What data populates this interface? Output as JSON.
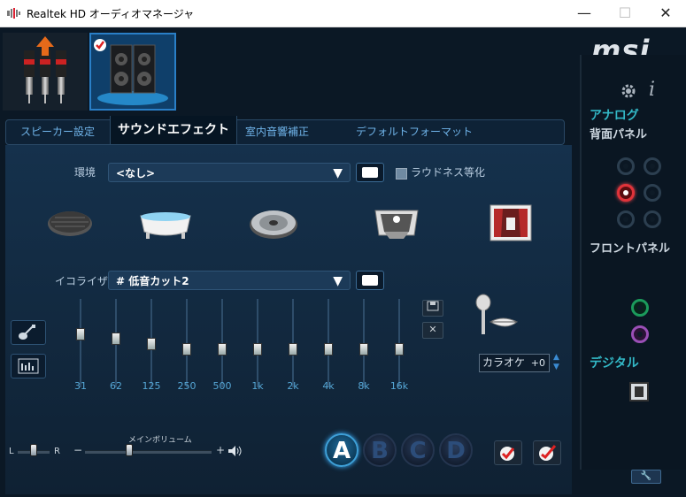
{
  "window": {
    "title": "Realtek HD オーディオマネージャ",
    "minimize": "—",
    "maximize": "☐",
    "close": "✕"
  },
  "brand": {
    "logo": "msi"
  },
  "tabs": [
    {
      "label": "スピーカー設定",
      "active": false
    },
    {
      "label": "サウンドエフェクト",
      "active": true
    },
    {
      "label": "室内音響補正",
      "active": false
    },
    {
      "label": "デフォルトフォーマット",
      "active": false
    }
  ],
  "environment": {
    "label": "環境",
    "selected": "<なし>",
    "icons": [
      "manhole-icon",
      "bathtub-icon",
      "disc-icon",
      "room-box-icon",
      "stage-icon"
    ]
  },
  "loudness": {
    "label": "ラウドネス等化",
    "checked": false
  },
  "equalizer": {
    "label": "イコライザ",
    "selected": "# 低音カット2",
    "bands": [
      {
        "label": "31",
        "level": 0.62
      },
      {
        "label": "62",
        "level": 0.56
      },
      {
        "label": "125",
        "level": 0.49
      },
      {
        "label": "250",
        "level": 0.42
      },
      {
        "label": "500",
        "level": 0.42
      },
      {
        "label": "1k",
        "level": 0.42
      },
      {
        "label": "2k",
        "level": 0.42
      },
      {
        "label": "4k",
        "level": 0.42
      },
      {
        "label": "8k",
        "level": 0.42
      },
      {
        "label": "16k",
        "level": 0.42
      }
    ]
  },
  "karaoke": {
    "label": "カラオケ",
    "value": "+0"
  },
  "right_panel": {
    "analog": "アナログ",
    "rear_panel": "背面パネル",
    "front_panel": "フロントパネル",
    "digital": "デジタル"
  },
  "volume": {
    "balance_left": "L",
    "balance_right": "R",
    "main_label": "メインボリューム",
    "minus": "−",
    "plus": "+",
    "balance_level": 0.5,
    "main_level": 0.35
  },
  "presets": [
    "A",
    "B",
    "C",
    "D"
  ],
  "active_preset": "A",
  "colors": {
    "accent": "#33b8c6",
    "background": "#0b1825",
    "jack_red": "#e0333a",
    "jack_green": "#1b9a5c",
    "jack_purple": "#9a4fb6"
  }
}
